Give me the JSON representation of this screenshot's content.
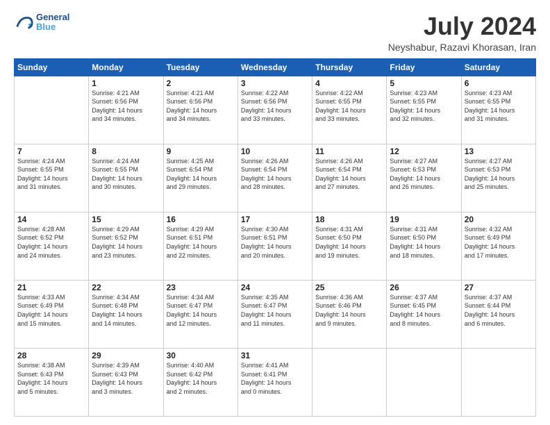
{
  "logo": {
    "line1": "General",
    "line2": "Blue"
  },
  "title": "July 2024",
  "subtitle": "Neyshabur, Razavi Khorasan, Iran",
  "days_header": [
    "Sunday",
    "Monday",
    "Tuesday",
    "Wednesday",
    "Thursday",
    "Friday",
    "Saturday"
  ],
  "weeks": [
    [
      {
        "num": "",
        "info": ""
      },
      {
        "num": "1",
        "info": "Sunrise: 4:21 AM\nSunset: 6:56 PM\nDaylight: 14 hours\nand 34 minutes."
      },
      {
        "num": "2",
        "info": "Sunrise: 4:21 AM\nSunset: 6:56 PM\nDaylight: 14 hours\nand 34 minutes."
      },
      {
        "num": "3",
        "info": "Sunrise: 4:22 AM\nSunset: 6:56 PM\nDaylight: 14 hours\nand 33 minutes."
      },
      {
        "num": "4",
        "info": "Sunrise: 4:22 AM\nSunset: 6:55 PM\nDaylight: 14 hours\nand 33 minutes."
      },
      {
        "num": "5",
        "info": "Sunrise: 4:23 AM\nSunset: 6:55 PM\nDaylight: 14 hours\nand 32 minutes."
      },
      {
        "num": "6",
        "info": "Sunrise: 4:23 AM\nSunset: 6:55 PM\nDaylight: 14 hours\nand 31 minutes."
      }
    ],
    [
      {
        "num": "7",
        "info": "Sunrise: 4:24 AM\nSunset: 6:55 PM\nDaylight: 14 hours\nand 31 minutes."
      },
      {
        "num": "8",
        "info": "Sunrise: 4:24 AM\nSunset: 6:55 PM\nDaylight: 14 hours\nand 30 minutes."
      },
      {
        "num": "9",
        "info": "Sunrise: 4:25 AM\nSunset: 6:54 PM\nDaylight: 14 hours\nand 29 minutes."
      },
      {
        "num": "10",
        "info": "Sunrise: 4:26 AM\nSunset: 6:54 PM\nDaylight: 14 hours\nand 28 minutes."
      },
      {
        "num": "11",
        "info": "Sunrise: 4:26 AM\nSunset: 6:54 PM\nDaylight: 14 hours\nand 27 minutes."
      },
      {
        "num": "12",
        "info": "Sunrise: 4:27 AM\nSunset: 6:53 PM\nDaylight: 14 hours\nand 26 minutes."
      },
      {
        "num": "13",
        "info": "Sunrise: 4:27 AM\nSunset: 6:53 PM\nDaylight: 14 hours\nand 25 minutes."
      }
    ],
    [
      {
        "num": "14",
        "info": "Sunrise: 4:28 AM\nSunset: 6:52 PM\nDaylight: 14 hours\nand 24 minutes."
      },
      {
        "num": "15",
        "info": "Sunrise: 4:29 AM\nSunset: 6:52 PM\nDaylight: 14 hours\nand 23 minutes."
      },
      {
        "num": "16",
        "info": "Sunrise: 4:29 AM\nSunset: 6:51 PM\nDaylight: 14 hours\nand 22 minutes."
      },
      {
        "num": "17",
        "info": "Sunrise: 4:30 AM\nSunset: 6:51 PM\nDaylight: 14 hours\nand 20 minutes."
      },
      {
        "num": "18",
        "info": "Sunrise: 4:31 AM\nSunset: 6:50 PM\nDaylight: 14 hours\nand 19 minutes."
      },
      {
        "num": "19",
        "info": "Sunrise: 4:31 AM\nSunset: 6:50 PM\nDaylight: 14 hours\nand 18 minutes."
      },
      {
        "num": "20",
        "info": "Sunrise: 4:32 AM\nSunset: 6:49 PM\nDaylight: 14 hours\nand 17 minutes."
      }
    ],
    [
      {
        "num": "21",
        "info": "Sunrise: 4:33 AM\nSunset: 6:49 PM\nDaylight: 14 hours\nand 15 minutes."
      },
      {
        "num": "22",
        "info": "Sunrise: 4:34 AM\nSunset: 6:48 PM\nDaylight: 14 hours\nand 14 minutes."
      },
      {
        "num": "23",
        "info": "Sunrise: 4:34 AM\nSunset: 6:47 PM\nDaylight: 14 hours\nand 12 minutes."
      },
      {
        "num": "24",
        "info": "Sunrise: 4:35 AM\nSunset: 6:47 PM\nDaylight: 14 hours\nand 11 minutes."
      },
      {
        "num": "25",
        "info": "Sunrise: 4:36 AM\nSunset: 6:46 PM\nDaylight: 14 hours\nand 9 minutes."
      },
      {
        "num": "26",
        "info": "Sunrise: 4:37 AM\nSunset: 6:45 PM\nDaylight: 14 hours\nand 8 minutes."
      },
      {
        "num": "27",
        "info": "Sunrise: 4:37 AM\nSunset: 6:44 PM\nDaylight: 14 hours\nand 6 minutes."
      }
    ],
    [
      {
        "num": "28",
        "info": "Sunrise: 4:38 AM\nSunset: 6:43 PM\nDaylight: 14 hours\nand 5 minutes."
      },
      {
        "num": "29",
        "info": "Sunrise: 4:39 AM\nSunset: 6:43 PM\nDaylight: 14 hours\nand 3 minutes."
      },
      {
        "num": "30",
        "info": "Sunrise: 4:40 AM\nSunset: 6:42 PM\nDaylight: 14 hours\nand 2 minutes."
      },
      {
        "num": "31",
        "info": "Sunrise: 4:41 AM\nSunset: 6:41 PM\nDaylight: 14 hours\nand 0 minutes."
      },
      {
        "num": "",
        "info": ""
      },
      {
        "num": "",
        "info": ""
      },
      {
        "num": "",
        "info": ""
      }
    ]
  ]
}
